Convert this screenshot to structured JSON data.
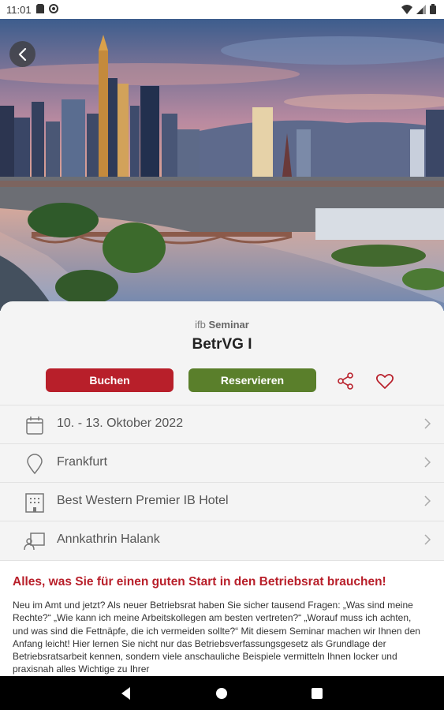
{
  "status_bar": {
    "time": "11:01"
  },
  "seminar": {
    "brand": "ifb",
    "category": "Seminar",
    "title": "BetrVG I"
  },
  "actions": {
    "book_label": "Buchen",
    "reserve_label": "Reservieren"
  },
  "details": {
    "date": "10. - 13. Oktober 2022",
    "location": "Frankfurt",
    "hotel": "Best Western Premier IB Hotel",
    "speaker": "Annkathrin Halank"
  },
  "description": {
    "heading": "Alles, was Sie für einen guten Start in den Betriebsrat brauchen!",
    "body": "Neu im Amt und jetzt? Als neuer Betriebsrat haben Sie sicher tausend Fragen: „Was sind meine Rechte?“ „Wie kann ich meine Arbeitskollegen am besten vertreten?“ „Worauf muss ich achten, und was sind die Fettnäpfe, die ich vermeiden sollte?“ Mit diesem Seminar machen wir Ihnen den Anfang leicht! Hier lernen Sie nicht nur das Betriebsverfassungsgesetz als Grundlage der Betriebsratsarbeit kennen, sondern viele anschauliche Beispiele vermitteln Ihnen locker und praxisnah alles Wichtige zu Ihrer"
  },
  "colors": {
    "primary_red": "#b81f2a",
    "primary_green": "#5a7f2b"
  }
}
